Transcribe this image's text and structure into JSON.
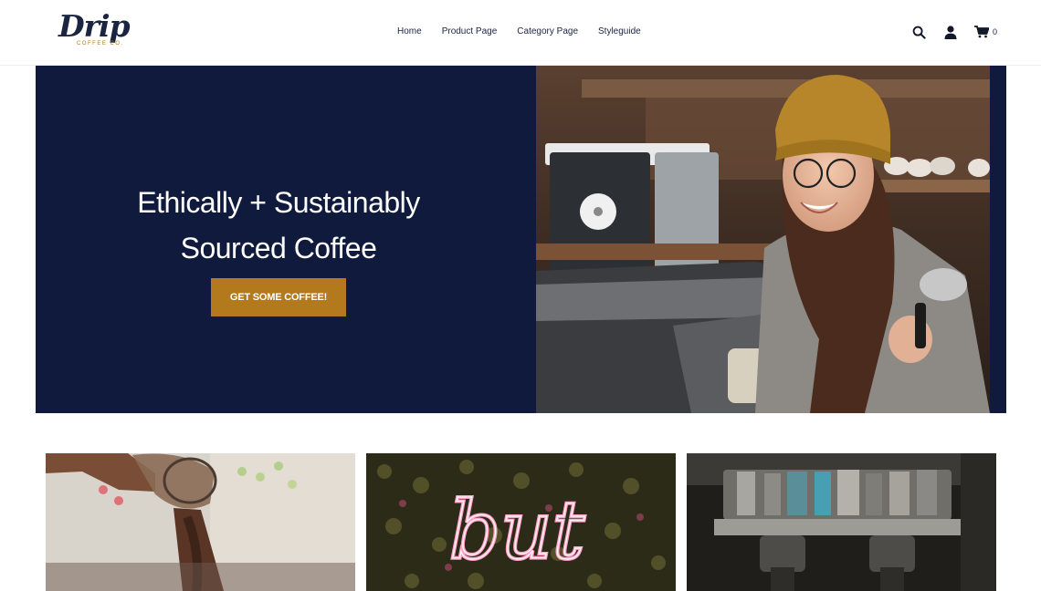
{
  "brand": {
    "name": "Drip",
    "sub": "COFFEE CO.",
    "colors": {
      "navy": "#0f1a3c",
      "accent": "#b27a1c",
      "text": "#1b2440"
    }
  },
  "nav": {
    "links": [
      "Home",
      "Product Page",
      "Category Page",
      "Styleguide"
    ]
  },
  "tools": {
    "search_icon": "search-icon",
    "account_icon": "user-icon",
    "cart_icon": "cart-icon",
    "cart_count": "0"
  },
  "hero": {
    "title_line1": "Ethically + Sustainably",
    "title_line2": "Sourced Coffee",
    "cta_label": "GET SOME COFFEE!",
    "image": "barista-smiling-photo"
  },
  "cards": [
    {
      "image": "coffee-grounds-pouring-photo"
    },
    {
      "image": "neon-but-sign-photo",
      "neon_text": "but"
    },
    {
      "image": "espresso-machine-photo"
    }
  ]
}
